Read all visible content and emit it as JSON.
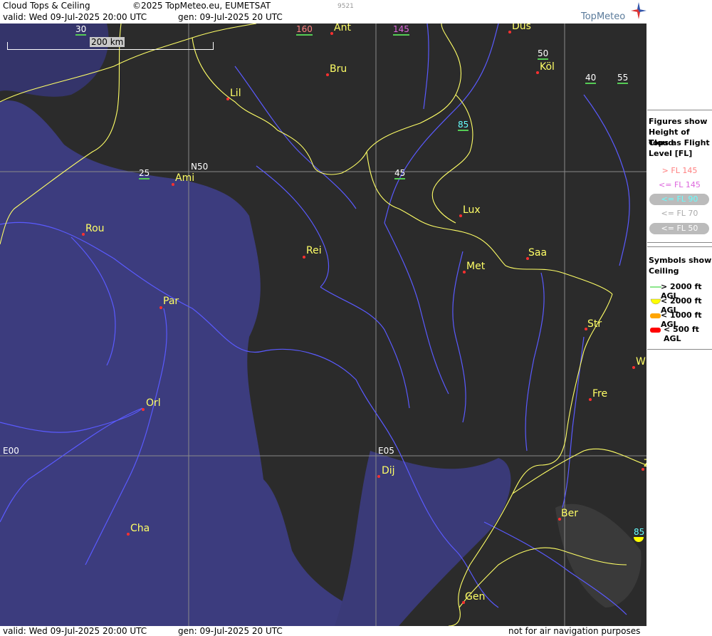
{
  "header": {
    "title": "Cloud Tops & Ceiling",
    "copyright": "©2025 TopMeteo.eu, EUMETSAT",
    "code": "9521",
    "valid": "valid:  Wed  09-Jul-2025  20:00 UTC",
    "gen": "gen: 09-Jul-2025 20 UTC",
    "logo": "TopMeteo"
  },
  "footer": {
    "valid": "valid:  Wed  09-Jul-2025  20:00 UTC",
    "gen": "gen: 09-Jul-2025 20 UTC",
    "disclaimer": "not for air navigation purposes"
  },
  "map": {
    "scale_label": "200 km",
    "grid_labels": {
      "lat50": "N50",
      "lon0": "E00",
      "lon5": "E05"
    },
    "cities": [
      {
        "name": "Ant"
      },
      {
        "name": "Düs"
      },
      {
        "name": "Bru"
      },
      {
        "name": "Köl"
      },
      {
        "name": "Lil"
      },
      {
        "name": "Ami"
      },
      {
        "name": "Rou"
      },
      {
        "name": "Rei"
      },
      {
        "name": "Lux"
      },
      {
        "name": "Saa"
      },
      {
        "name": "Met"
      },
      {
        "name": "Par"
      },
      {
        "name": "Str"
      },
      {
        "name": "W"
      },
      {
        "name": "Fre"
      },
      {
        "name": "Orl"
      },
      {
        "name": "Dij"
      },
      {
        "name": "Ber"
      },
      {
        "name": "Cha"
      },
      {
        "name": "Gen"
      },
      {
        "name": "Z"
      }
    ],
    "cloud_tops": [
      {
        "value": "30",
        "color": "#ffffff"
      },
      {
        "value": "160",
        "color": "#ff8080"
      },
      {
        "value": "145",
        "color": "#dd66dd"
      },
      {
        "value": "50",
        "color": "#ffffff"
      },
      {
        "value": "40",
        "color": "#ffffff"
      },
      {
        "value": "55",
        "color": "#ffffff"
      },
      {
        "value": "85",
        "color": "#66ffff"
      },
      {
        "value": "25",
        "color": "#ffffff"
      },
      {
        "value": "45",
        "color": "#ffffff"
      },
      {
        "value": "85",
        "color": "#66ffff"
      }
    ]
  },
  "legend": {
    "tops_title": [
      "Figures show",
      "Height of Cloud",
      "Tops as Flight",
      "Level  [FL]"
    ],
    "tops_items": [
      {
        "label": "> FL 145",
        "color": "#ff8080",
        "pill": false
      },
      {
        "label": "<= FL 145",
        "color": "#dd66dd",
        "pill": false
      },
      {
        "label": "<= FL 90",
        "color": "#66ffff",
        "pill": true
      },
      {
        "label": "<= FL 70",
        "color": "#aaaaaa",
        "pill": false
      },
      {
        "label": "<= FL 50",
        "color": "#ffffff",
        "pill": true
      }
    ],
    "ceiling_title": [
      "Symbols show",
      "Ceiling"
    ],
    "ceiling_items": [
      {
        "label": "> 2000 ft AGL",
        "color": "#66dd66"
      },
      {
        "label": "< 2000 ft AGL",
        "color": "#ffff00"
      },
      {
        "label": "< 1000 ft AGL",
        "color": "#ffa500"
      },
      {
        "label": "< 500 ft AGL",
        "color": "#ff0000"
      }
    ]
  }
}
